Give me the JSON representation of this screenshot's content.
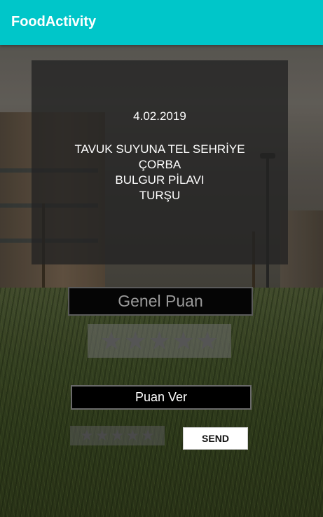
{
  "app": {
    "title": "FoodActivity",
    "accent_color": "#00c6c9"
  },
  "menu": {
    "date": "4.02.2019",
    "items": [
      "TAVUK SUYUNA TEL SEHRİYE",
      "ÇORBA",
      "BULGUR PİLAVI",
      "TURŞU"
    ]
  },
  "rating": {
    "overall_label": "Genel Puan",
    "overall_stars_max": 5,
    "overall_stars_value": 0,
    "give_label": "Puan Ver",
    "give_stars_max": 5,
    "give_stars_value": 0,
    "send_label": "SEND"
  },
  "icons": {
    "star": "star-icon"
  }
}
